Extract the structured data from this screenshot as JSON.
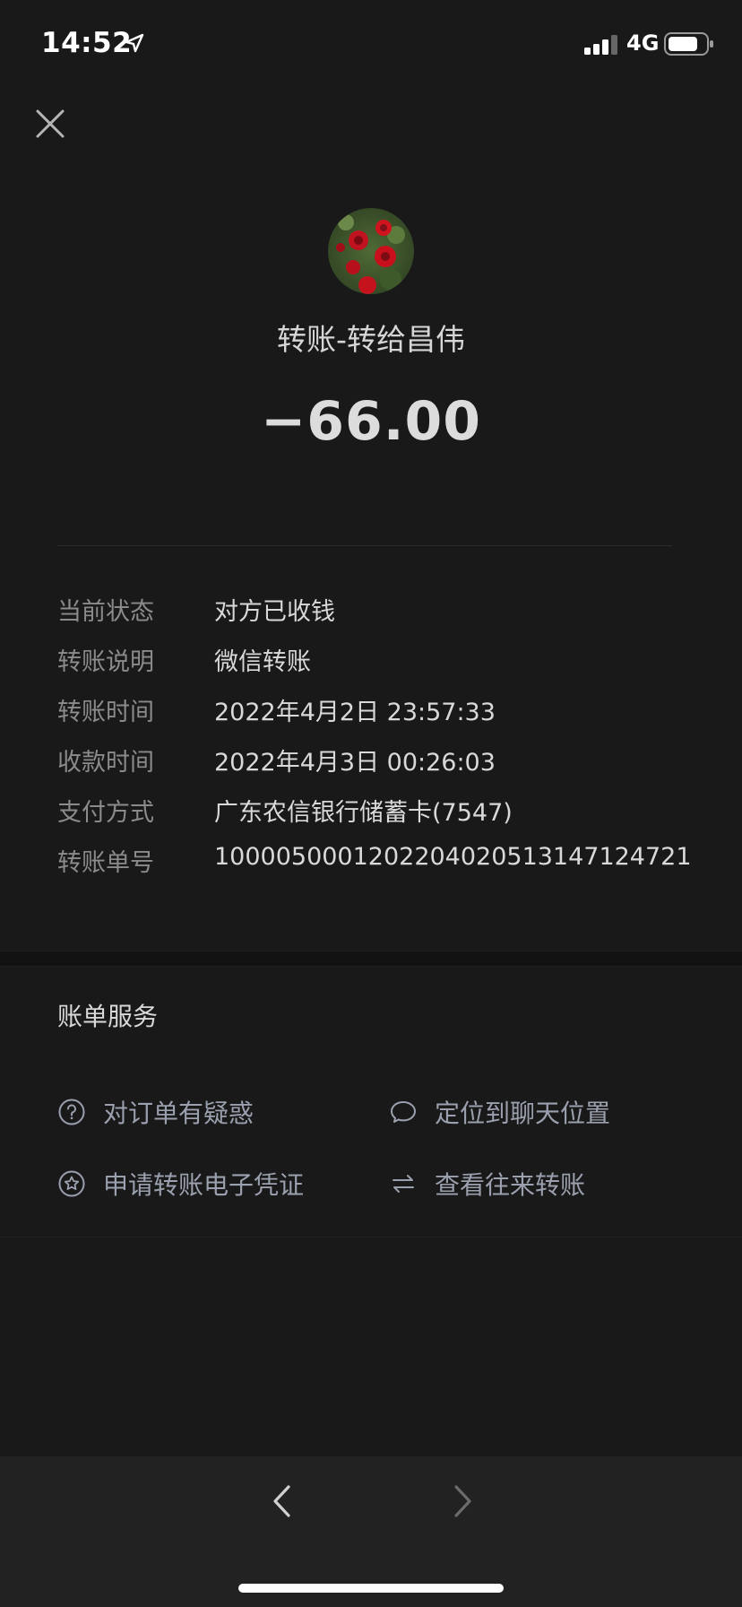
{
  "status_bar": {
    "time": "14:52",
    "network": "4G"
  },
  "header": {
    "close_icon": "close-icon"
  },
  "transaction": {
    "title": "转账-转给昌伟",
    "amount": "−66.00"
  },
  "details": [
    {
      "label": "当前状态",
      "value": "对方已收钱"
    },
    {
      "label": "转账说明",
      "value": "微信转账"
    },
    {
      "label": "转账时间",
      "value": "2022年4月2日 23:57:33"
    },
    {
      "label": "收款时间",
      "value": "2022年4月3日 00:26:03"
    },
    {
      "label": "支付方式",
      "value": "广东农信银行储蓄卡(7547)"
    },
    {
      "label": "转账单号",
      "value": "1000050001202204020513147124721"
    }
  ],
  "services": {
    "title": "账单服务",
    "items": [
      {
        "label": "对订单有疑惑",
        "icon": "question-icon"
      },
      {
        "label": "定位到聊天位置",
        "icon": "chat-bubble-icon"
      },
      {
        "label": "申请转账电子凭证",
        "icon": "star-badge-icon"
      },
      {
        "label": "查看往来转账",
        "icon": "swap-arrows-icon"
      }
    ]
  },
  "colors": {
    "background": "#191919",
    "label": "#8b8b8b",
    "value": "#d9d9d9",
    "link": "#9aa0ad"
  }
}
